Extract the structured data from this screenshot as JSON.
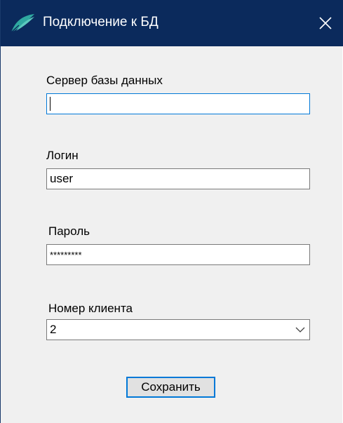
{
  "window": {
    "title": "Подключение к БД",
    "icon": "app-feather-icon",
    "close_icon": "close-icon",
    "titlebar_color": "#0b2a5c",
    "accent_color": "#0078d7"
  },
  "form": {
    "server": {
      "label": "Сервер базы данных",
      "value": ""
    },
    "login": {
      "label": "Логин",
      "value": "user"
    },
    "password": {
      "label": "Пароль",
      "value": "*********"
    },
    "client_number": {
      "label": "Номер клиента",
      "selected": "2",
      "icon": "chevron-down-icon"
    },
    "save_label": "Сохранить"
  }
}
